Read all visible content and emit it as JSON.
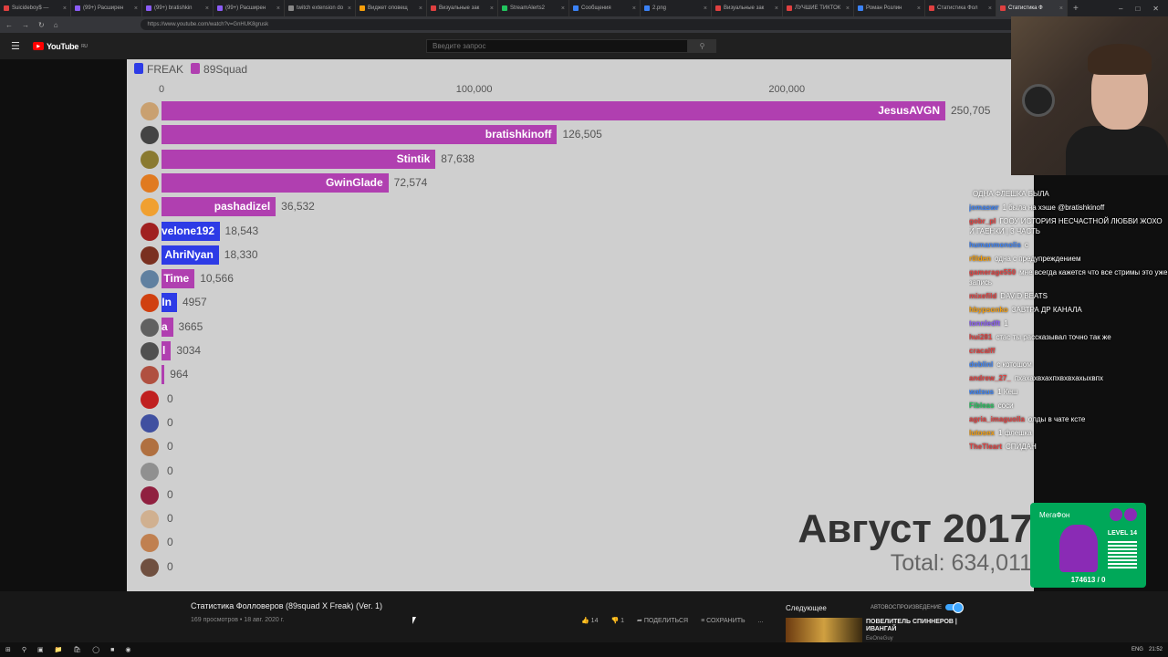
{
  "browser": {
    "tabs": [
      {
        "label": "Suicideboy$ —",
        "color": "#e04040"
      },
      {
        "label": "(99+) Расшиpен",
        "color": "#8b5cf6"
      },
      {
        "label": "(99+) bratishkin",
        "color": "#8b5cf6"
      },
      {
        "label": "(99+) Расшиpен",
        "color": "#8b5cf6"
      },
      {
        "label": "twitch extension do",
        "color": "#888888"
      },
      {
        "label": "Виджет оповещ",
        "color": "#f59e0b"
      },
      {
        "label": "Визуальные зак",
        "color": "#e04040"
      },
      {
        "label": "StreamAlerts2",
        "color": "#22c55e"
      },
      {
        "label": "Сообщения",
        "color": "#3b82f6"
      },
      {
        "label": "2.png",
        "color": "#3b82f6"
      },
      {
        "label": "Визуальные зак",
        "color": "#e04040"
      },
      {
        "label": "ЛУЧШИЕ ТИКТОК",
        "color": "#e04040"
      },
      {
        "label": "Роман Розлин",
        "color": "#3b82f6"
      },
      {
        "label": "Статистика Фол",
        "color": "#e04040"
      },
      {
        "label": "Статистика Ф",
        "color": "#e04040"
      }
    ],
    "active_tab": 14,
    "url": "https://www.youtube.com/watch?v=GnHUK8grusk"
  },
  "youtube": {
    "logo_text": "YouTube",
    "logo_sup": "RU",
    "search_placeholder": "Введите запрос"
  },
  "chart_data": {
    "type": "bar",
    "legend": [
      {
        "name": "FREAK",
        "color": "#2d3be6"
      },
      {
        "name": "89Squad",
        "color": "#b03fb0"
      }
    ],
    "xlim": [
      0,
      250705
    ],
    "ticks": [
      {
        "value": 0,
        "label": "0"
      },
      {
        "value": 100000,
        "label": "100,000"
      },
      {
        "value": 200000,
        "label": "200,000"
      }
    ],
    "bars": [
      {
        "name": "JesusAVGN",
        "value": 250705,
        "label": "250,705",
        "team": "89Squad",
        "avatar": "#c9a070"
      },
      {
        "name": "bratishkinoff",
        "value": 126505,
        "label": "126,505",
        "team": "89Squad",
        "avatar": "#444444"
      },
      {
        "name": "Stintik",
        "value": 87638,
        "label": "87,638",
        "team": "89Squad",
        "avatar": "#8a7a30"
      },
      {
        "name": "GwinGlade",
        "value": 72574,
        "label": "72,574",
        "team": "89Squad",
        "avatar": "#e07a20"
      },
      {
        "name": "pashadizel",
        "value": 36532,
        "label": "36,532",
        "team": "89Squad",
        "avatar": "#f0a030"
      },
      {
        "name": "velone192",
        "value": 18543,
        "label": "18,543",
        "team": "FREAK",
        "avatar": "#a02020"
      },
      {
        "name": "AhriNyan",
        "value": 18330,
        "label": "18,330",
        "team": "FREAK",
        "avatar": "#7a3020"
      },
      {
        "name": "Time",
        "value": 10566,
        "label": "10,566",
        "team": "89Squad",
        "avatar": "#6080a0"
      },
      {
        "name": "In",
        "value": 4957,
        "label": "4957",
        "team": "FREAK",
        "avatar": "#d04010"
      },
      {
        "name": "a",
        "value": 3665,
        "label": "3665",
        "team": "89Squad",
        "avatar": "#606060"
      },
      {
        "name": "l",
        "value": 3034,
        "label": "3034",
        "team": "89Squad",
        "avatar": "#505050"
      },
      {
        "name": "",
        "value": 964,
        "label": "964",
        "team": "89Squad",
        "avatar": "#b05040"
      },
      {
        "name": "",
        "value": 0,
        "label": "0",
        "team": "89Squad",
        "avatar": "#c02020"
      },
      {
        "name": "",
        "value": 0,
        "label": "0",
        "team": "89Squad",
        "avatar": "#4050a0"
      },
      {
        "name": "",
        "value": 0,
        "label": "0",
        "team": "89Squad",
        "avatar": "#b07040"
      },
      {
        "name": "",
        "value": 0,
        "label": "0",
        "team": "89Squad",
        "avatar": "#909090"
      },
      {
        "name": "",
        "value": 0,
        "label": "0",
        "team": "89Squad",
        "avatar": "#902040"
      },
      {
        "name": "",
        "value": 0,
        "label": "0",
        "team": "89Squad",
        "avatar": "#d0b090"
      },
      {
        "name": "",
        "value": 0,
        "label": "0",
        "team": "89Squad",
        "avatar": "#c08050"
      },
      {
        "name": "",
        "value": 0,
        "label": "0",
        "team": "89Squad",
        "avatar": "#705040"
      }
    ],
    "date": "Август 2017",
    "total": "Total: 634,011"
  },
  "chat": [
    {
      "user": "",
      "color": "#ffffff",
      "text": "ОДНА ФЛЕШКА БЫЛА"
    },
    {
      "user": "jomaswr",
      "color": "#3b82f6",
      "text": "1 была на хэше @bratishkinoff"
    },
    {
      "user": "gobr_pl",
      "color": "#e04040",
      "text": "ГООУ ИСТОРИЯ НЕСЧАСТНОЙ ЛЮБВИ ЖОХО И ГАЕНКИ | 3 ЧАСТЬ"
    },
    {
      "user": "humanmonolis",
      "color": "#3b82f6",
      "text": "с"
    },
    {
      "user": "r0lden",
      "color": "#f59e0b",
      "text": "одна с предупреждением"
    },
    {
      "user": "gamerage550",
      "color": "#e04040",
      "text": "мне всегда кажется что все стримы это уже запись"
    },
    {
      "user": "mixefild",
      "color": "#e04040",
      "text": "DAVID BEATS"
    },
    {
      "user": "hbypsonko",
      "color": "#f59e0b",
      "text": "ЗАВТРА ДР КАНАЛА"
    },
    {
      "user": "tonnledft",
      "color": "#8b5cf6",
      "text": "1"
    },
    {
      "user": "hui281",
      "color": "#e04040",
      "text": "стас ты рассказывал точно так же"
    },
    {
      "user": "cracalff",
      "color": "#e04040",
      "text": ""
    },
    {
      "user": "doblinl",
      "color": "#3b82f6",
      "text": "с котошом"
    },
    {
      "user": "andrew_27_",
      "color": "#e04040",
      "text": "пхахахвхахпхвхвхахыхвпх"
    },
    {
      "user": "watsus",
      "color": "#3b82f6",
      "text": "1 Кеш"
    },
    {
      "user": "Fibleas",
      "color": "#22c55e",
      "text": "соси"
    },
    {
      "user": "agria_imaguolla",
      "color": "#e04040",
      "text": "олды в чате ксте"
    },
    {
      "user": "lutosex",
      "color": "#f59e0b",
      "text": "1 флешка"
    },
    {
      "user": "TheTleart",
      "color": "#e04040",
      "text": "СПИДАН"
    }
  ],
  "widget": {
    "title": "МегаФон",
    "level": "LEVEL 14",
    "score": "174613 / 0"
  },
  "video_info": {
    "title": "Статистика Фолловеров (89squad X Freak) (Ver. 1)",
    "meta": "169 просмотров • 18 авг. 2020 г.",
    "likes": "14",
    "dislikes": "1",
    "share": "ПОДЕЛИТЬСЯ",
    "save": "СОХРАНИТЬ",
    "more": "..."
  },
  "sidebar_next": {
    "label": "Следующее",
    "autoplay": "АВТОВОСПРОИЗВЕДЕНИЕ",
    "next_title": "ПОВЕЛИТЕЛЬ СПИННЕРОВ | ИВАНГАЙ",
    "next_channel": "EeOneGuy"
  },
  "taskbar": {
    "lang": "ENG",
    "time": "21:52"
  }
}
